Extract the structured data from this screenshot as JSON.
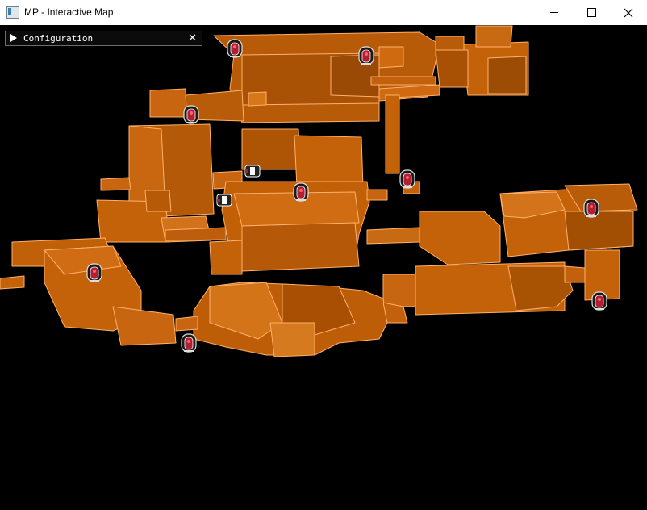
{
  "window": {
    "title": "MP - Interactive Map",
    "minimize_icon": "minimize-icon",
    "maximize_icon": "maximize-icon",
    "close_icon": "close-icon"
  },
  "config_panel": {
    "label": "Configuration",
    "expand_icon": "triangle-right-icon",
    "close_icon": "close-icon"
  },
  "map": {
    "background_color": "#000000",
    "room_fill_color": "#c4620a",
    "room_edge_color": "#ffb06a",
    "marker_icon": "door-marker-icon",
    "marker_color": "#c0303a"
  }
}
